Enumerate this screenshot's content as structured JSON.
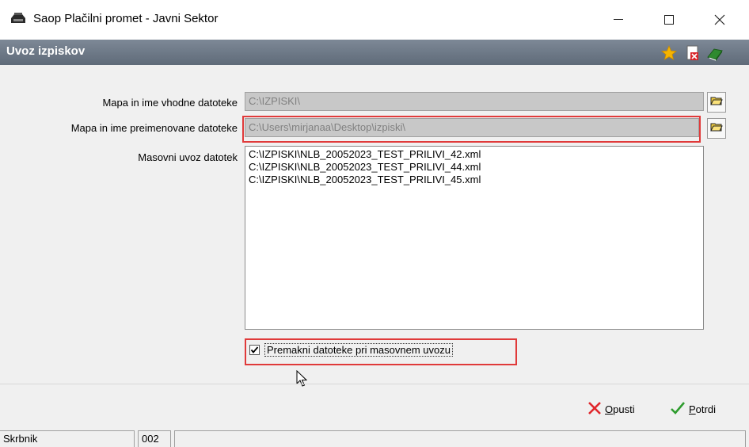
{
  "window": {
    "title": "Saop Plačilni promet - Javni Sektor",
    "app_icon": "printer-icon"
  },
  "header": {
    "title": "Uvoz izpiskov",
    "icons": [
      "star-icon",
      "pdf-close-icon",
      "book-icon"
    ]
  },
  "form": {
    "input_label": "Mapa in ime vhodne datoteke",
    "input_value": "C:\\IZPISKI\\",
    "renamed_label": "Mapa in ime preimenovane datoteke",
    "renamed_value": "C:\\Users\\mirjanaa\\Desktop\\izpiski\\",
    "mass_label": "Masovni uvoz datotek",
    "files": [
      "C:\\IZPISKI\\NLB_20052023_TEST_PRILIVI_42.xml",
      "C:\\IZPISKI\\NLB_20052023_TEST_PRILIVI_44.xml",
      "C:\\IZPISKI\\NLB_20052023_TEST_PRILIVI_45.xml"
    ],
    "move_checkbox_label": "Premakni datoteke pri masovnem uvozu",
    "move_checked": true
  },
  "buttons": {
    "cancel_prefix": "O",
    "cancel_rest": "pusti",
    "confirm_prefix": "P",
    "confirm_rest": "otrdi"
  },
  "status": {
    "user": "Skrbnik",
    "code": "002",
    "message": ""
  },
  "colors": {
    "header_bg": "#6b7684",
    "highlight": "#e03a3a",
    "field_bg": "#c8c8c8"
  }
}
